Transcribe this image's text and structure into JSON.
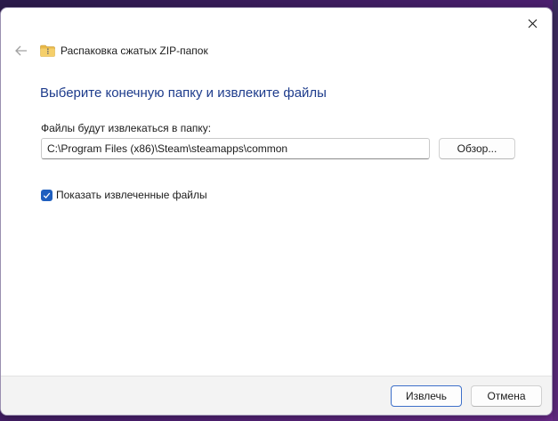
{
  "window": {
    "title": "Распаковка сжатых ZIP-папок"
  },
  "icons": {
    "close": "close-icon",
    "back": "back-arrow-icon",
    "zip": "zip-folder-icon",
    "check": "checkmark-icon"
  },
  "colors": {
    "heading": "#1e3c8c",
    "accent": "#1f5fbf",
    "zip_folder": "#e9b949"
  },
  "main": {
    "heading": "Выберите конечную папку и извлеките файлы",
    "destination_label": "Файлы будут извлекаться в папку:",
    "destination_path": "C:\\Program Files (x86)\\Steam\\steamapps\\common",
    "browse_label": "Обзор...",
    "show_files_label": "Показать извлеченные файлы",
    "show_files_checked": true
  },
  "footer": {
    "extract_label": "Извлечь",
    "cancel_label": "Отмена"
  }
}
